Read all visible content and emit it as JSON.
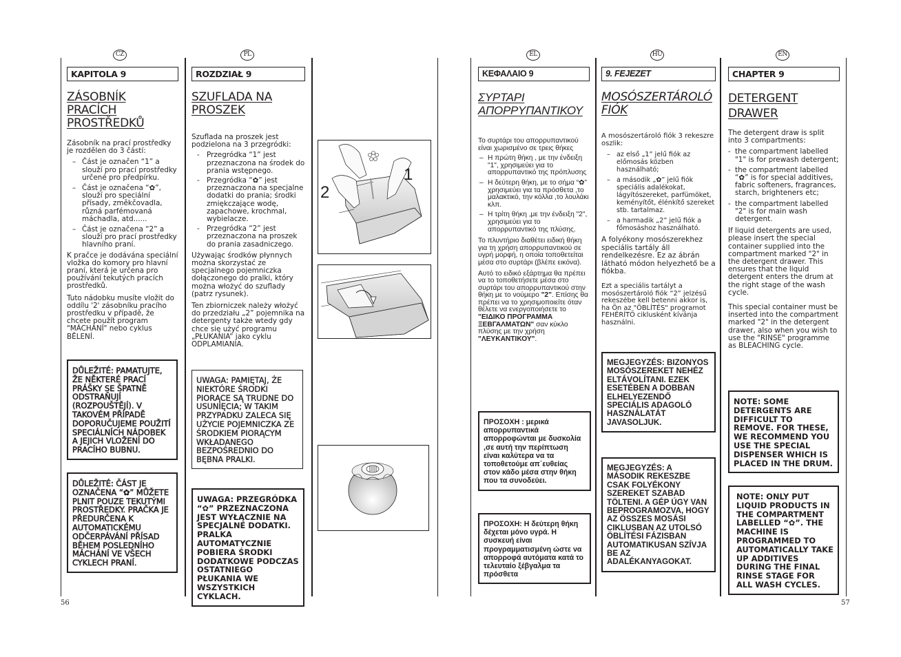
{
  "pages": {
    "left_number": "56",
    "right_number": "57"
  },
  "cz": {
    "badge": "CZ",
    "chapter": "KAPITOLA 9",
    "title_line1": "ZÁSOBNÍK PRACÍCH",
    "title_line2": "PROSTŘEDKŮ",
    "intro": "Zásobník na prací prostředky je rozdělen do 3 částí:",
    "items": [
      "Část je označen “1” a slouží pro prací prostředky určené pro předpírku.",
      "Část je označena “✿”, slouží pro speciální přísady, změkčovadla, různá parfémovaná máchadla, atd......",
      "Část je označena “2” a slouží pro prací prostředky  hlavního praní."
    ],
    "para1": "K pračce je dodávána speciální vložka do komory pro hlavní praní, která je určena pro používání tekutých pracích prostředků.",
    "para2": "Tuto nádobku musíte vložit do oddílu '2' zásobníku pracího prostředku v případě, že chcete použít program \"MÁCHÁNÍ\" nebo cyklus BĚLENÍ.",
    "note1": "DŮLEŽITÉ: PAMATUJTE, ŽE NĚKTERÉ PRACÍ PRÁŠKY SE ŠPATNĚ ODSTRAŇUJÍ (ROZPOUŠTĚJÍ). V TAKOVÉM PŘÍPADĚ DOPORUČUJEME POUŽITÍ SPECIÁLNÍCH NÁDOBEK A JEJICH VLOŽENÍ DO PRACÍHO BUBNU.",
    "note2": "DŮLEŽITÉ: ČÁST JE OZNAČENA “✿” MŮŽETE PLNIT POUZE TEKUTÝMI PROSTŘEDKY. PRAČKA JE PŘEDURČENA K AUTOMATICKÉMU ODČERPÁVÁNÍ PŘÍSAD BĚHEM POSLEDNÍHO MÁCHÁNÍ VE VŠECH CYKLECH PRANÍ."
  },
  "pl": {
    "badge": "PL",
    "chapter": "ROZDZIAŁ 9",
    "title_line1": "SZUFLADA NA",
    "title_line2": "PROSZEK",
    "intro": "Szuflada na proszek jest podzielona na 3 przegródki:",
    "items": [
      "Przegródka “1” jest przeznaczona na środek do prania wstępnego.",
      "Przegródka “✿” jest przeznaczona na specjalne dodatki do prania; środki zmiękczające wodę, zapachowe, krochmal, wybielacze.",
      "Przegródka “2” jest przeznaczona na proszek do prania zasadniczego."
    ],
    "para1": "Używając środków płynnych można skorzystać ze specjalnego pojemniczka dołączonego do pralki, który można włożyć do szuflady (patrz rysunek).",
    "para2": "Ten zbiorniczek należy włożyć do przedziału „2” pojemnika na detergenty także wtedy gdy chce się użyć programu „PŁUKANIA” jako cyklu ODPLAMIANIA.",
    "note1": "UWAGA: PAMIĘTAJ, ŻE NIEKTÓRE ŚRODKI PIORĄCE SĄ TRUDNE DO USUNIĘCIA; W TAKIM PRZYPADKU ZALECA SIĘ UŻYCIE POJEMNICZKA ZE ŚRODKIEM PIORĄCYM WKŁADANEGO BEZPOŚREDNIO DO BĘBNA PRALKI.",
    "note2": "UWAGA: PRZEGRÓDKA “✿” PRZEZNACZONA JEST WYŁĄCZNIE NA SPECJALNE DODATKI. PRALKA AUTOMATYCZNIE POBIERA ŚRODKI DODATKOWE PODCZAS OSTATNIEGO PŁUKANIA WE WSZYSTKICH CYKLACH."
  },
  "figures": {
    "fig1_label_left": "2",
    "fig1_label_right": "1",
    "fig1_desc": "detergent-drawer-with-pouring-bottles",
    "fig2_desc": "liquid-detergent-container-insert",
    "fig3_desc": "dosing-ball"
  },
  "el": {
    "badge": "EL",
    "chapter": "ΚΕΦΑΛΑΙΟ 9",
    "title_line1": "ΣΥΡΤΑΡΙ",
    "title_line2": "ΑΠΟΡΡΥΠΑΝΤΙΚΟΥ",
    "intro": "Το συρτάρι του απορρυπαντικού είναι χωρισμένο σε τρεις θήκες",
    "items": [
      "Η πρώτη θήκη , με την ένδειξη \"1\", χρησιμεύει  για το απορρυπαντικό της πρόπλυσης",
      "Η δεύτερη θήκη, με το σήμα “✿” χρησιμεύει για  τα πρόσθετα ,το μαλακτικό, την κόλλα ,το λουλάκι κλπ.",
      "Η τρίτη θήκη ,με την ένδειξη \"2\", χρησιμεύει  για το απορρυπαντικό της πλύσης."
    ],
    "para1": "Το πλυντήριο διαθέτει ειδική θήκη για τη χρήση απορρυπαντικού σε υγρή μορφή, η οποία τοποθετείται μέσα στο συρτάρι (βλέπε εικόνα).",
    "para2_a": "Αυτό το ειδικό εξάρτημα θα πρέπει να το τοποθετήσετε μέσα στο συρτάρι του απορρυπαντικού στην θήκη με το νούμερο ",
    "para2_b": "\"2\"",
    "para2_c": ". Επίσης θα πρέπει να το χρησιμοποιείτε όταν θέλετε να ενεργοποιήσετε το ",
    "para2_d": "\"ΕΙΔΙΚΟ ΠΡΟΓΡΑΜΜΑ ΞΕΒΓΑΛΜΑΤΩΝ\"",
    "para2_e": " σαν κύκλο πλύσης με την χρήση ",
    "para2_f": "\"ΛΕΥΚΑΝΤΙΚΟΥ\"",
    "para2_g": ".",
    "note1": "ΠΡΟΣΟΧΗ : μερικά απορρυπαντικά απορροφώνται με δυσκολία ,σε αυτή την περίπτωση είναι καλύτερα να τα τοποθετούμε απ΄ευθείας στον κάδο μέσα στην θήκη που τα συνοδεύει.",
    "note2": "ΠΡΟΣΟΧΗ: Η δεύτερη θήκη δέχεται μόνο υγρά. Η συσκευή είναι προγραμματισμένη ώστε να απορροφά αυτόματα  κατά το τελευταίο ξέβγαλμα τα πρόσθετα"
  },
  "hu": {
    "badge": "HU",
    "chapter": "9. FEJEZET",
    "title_line1": "MOSÓSZERTÁROLÓ",
    "title_line2": "FIÓK",
    "intro": "A mosószertároló fiók 3 rekeszre oszlik:",
    "items": [
      "az első „1” jelű fiók az előmosás közben használható;",
      "a második „✿” jelű fiók speciális adalékokat, lágyítószereket, parfümöket, keményítőt, élénkítő szereket stb. tartalmaz.",
      "a harmadik „2” jelű fiók a főmosáshoz használható."
    ],
    "para1": "A folyékony  mosószerekhez speciális tartály áll rendelkezésre. Ez az ábrán látható módon helyezhető be a fiókba.",
    "para2": "Ezt a speciális tartályt a mosószertároló fiók “2” jelzésű rekeszébe kell betenni akkor is, ha Ön az \"ÖBLÍTÉS\" programot FEHÉRÍTŐ ciklusként kívánja használni.",
    "note1": "MEGJEGYZÉS: BIZONYOS MOSÓSZEREKET NEHÉZ ELTÁVOLÍTANI. EZEK ESETÉBEN A DOBBAN ELHELYEZENDŐ SPECIÁLIS ADAGOLÓ HASZNÁLATÁT JAVASOLJUK.",
    "note2": "MEGJEGYZÉS: A MÁSODIK REKESZBE CSAK FOLYÉKONY SZEREKET SZABAD TÖLTENI. A GÉP ÚGY VAN BEPROGRAMOZVA, HOGY AZ ÖSSZES MOSÁSI CIKLUSBAN AZ UTOLSÓ ÖBLÍTÉSI FÁZISBAN AUTOMATIKUSAN SZÍVJA BE AZ ADALÉKANYAGOKAT."
  },
  "en": {
    "badge": "EN",
    "chapter": "CHAPTER 9",
    "title_line1": "DETERGENT",
    "title_line2": "DRAWER",
    "intro": "The detergent draw is split into 3 compartments:",
    "items": [
      "the compartment labelled \"1\" is for prewash detergent;",
      "the compartment labelled “✿” is for special additives, fabric softeners, fragrances, starch, brighteners etc;",
      "the compartment labelled \"2\" is for main wash detergent."
    ],
    "para1": "If liquid detergents are used, please insert the special container supplied into the compartment marked \"2\" in the detergent drawer. This ensures that the liquid detergent enters the drum at the right stage of the wash cycle.",
    "para2": "This special container must be inserted into the compartment marked \"2\" in the detergent drawer, also when you wish to use the \"RINSE\" programme as BLEACHING cycle.",
    "note1": "NOTE: SOME DETERGENTS ARE DIFFICULT TO REMOVE. FOR THESE, WE RECOMMEND YOU USE THE SPECIAL DISPENSER WHICH IS PLACED IN THE DRUM.",
    "note2": "NOTE: ONLY PUT LIQUID PRODUCTS IN THE COMPARTMENT LABELLED “✿”. THE MACHINE IS PROGRAMMED TO AUTOMATICALLY TAKE UP ADDITIVES DURING THE FINAL RINSE STAGE FOR ALL WASH CYCLES."
  }
}
